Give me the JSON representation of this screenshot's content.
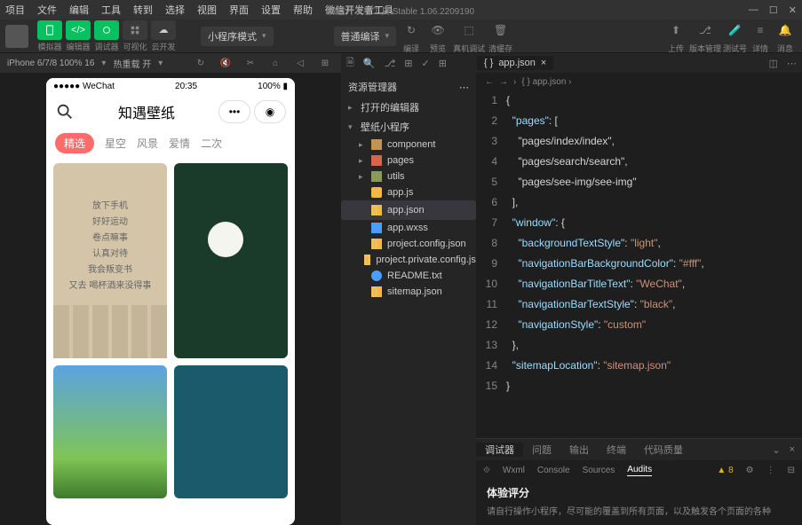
{
  "titlebar": {
    "menus": [
      "项目",
      "文件",
      "编辑",
      "工具",
      "转到",
      "选择",
      "视图",
      "界面",
      "设置",
      "帮助",
      "微信开发者工具"
    ],
    "title": "微信开发者工具 Stable 1.06.2209190"
  },
  "toolbar": {
    "labels": [
      "模拟器",
      "编辑器",
      "调试器",
      "可视化",
      "云开发"
    ],
    "mode_select": "小程序模式",
    "compile_select": "普通编译",
    "compile_label": "编译",
    "preview_label": "预览",
    "remote_label": "真机调试",
    "clear_label": "清缓存",
    "upload_label": "上传",
    "version_label": "版本管理",
    "test_label": "测试号",
    "detail_label": "详情",
    "msg_label": "消息"
  },
  "sim": {
    "device": "iPhone 6/7/8 100% 16",
    "hot": "热重载 开"
  },
  "phone": {
    "carrier": "●●●●● WeChat",
    "wifi": "⌔",
    "time": "20:35",
    "battery": "100%",
    "title": "知遇壁纸",
    "tabs": [
      "精选",
      "星空",
      "风景",
      "爱情",
      "二次"
    ],
    "card1_lines": [
      "放下手机",
      "好好运动",
      "卷点嘛事",
      "认真对待",
      "我会叛变书",
      "又去 喝杯酒来没得事"
    ]
  },
  "explorer": {
    "title": "资源管理器",
    "open_editors": "打开的编辑器",
    "project": "壁纸小程序",
    "folders": [
      "component",
      "pages",
      "utils"
    ],
    "files": [
      "app.js",
      "app.json",
      "app.wxss",
      "project.config.json",
      "project.private.config.js...",
      "README.txt",
      "sitemap.json"
    ]
  },
  "editor_tab": "app.json",
  "breadcrumb": [
    "app.json"
  ],
  "code": {
    "lines": [
      "{",
      "  \"pages\": [",
      "    \"pages/index/index\",",
      "    \"pages/search/search\",",
      "    \"pages/see-img/see-img\"",
      "  ],",
      "  \"window\": {",
      "    \"backgroundTextStyle\": \"light\",",
      "    \"navigationBarBackgroundColor\": \"#fff\",",
      "    \"navigationBarTitleText\": \"WeChat\",",
      "    \"navigationBarTextStyle\": \"black\",",
      "    \"navigationStyle\": \"custom\"",
      "  },",
      "  \"sitemapLocation\": \"sitemap.json\"",
      "}"
    ]
  },
  "debugger": {
    "tabs": [
      "调试器",
      "问题",
      "输出",
      "终端",
      "代码质量"
    ],
    "subtabs": [
      "Wxml",
      "Console",
      "Sources",
      "Audits"
    ],
    "warn_count": "8",
    "audit_title": "体验评分",
    "audit_desc": "请自行操作小程序，尽可能的覆盖到所有页面，以及触发各个页面的各种"
  }
}
